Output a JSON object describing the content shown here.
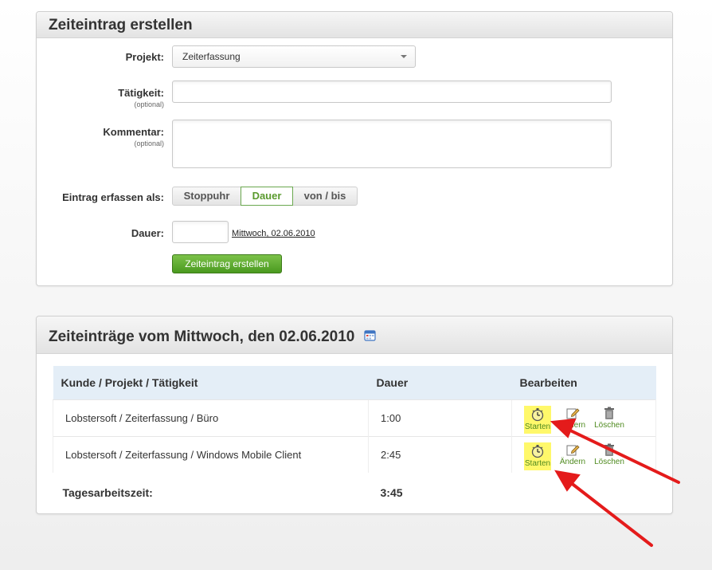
{
  "form": {
    "title": "Zeiteintrag erstellen",
    "project_label": "Projekt:",
    "project_value": "Zeiterfassung",
    "activity_label": "Tätigkeit:",
    "activity_hint": "(optional)",
    "comment_label": "Kommentar:",
    "comment_hint": "(optional)",
    "mode_label": "Eintrag erfassen als:",
    "modes": [
      "Stoppuhr",
      "Dauer",
      "von / bis"
    ],
    "active_mode": "Dauer",
    "duration_label": "Dauer:",
    "date_link": "Mittwoch, 02.06.2010",
    "submit_label": "Zeiteintrag erstellen"
  },
  "entries": {
    "title": "Zeiteinträge vom Mittwoch, den 02.06.2010",
    "columns": [
      "Kunde / Projekt / Tätigkeit",
      "Dauer",
      "Bearbeiten"
    ],
    "rows": [
      {
        "task": "Lobstersoft / Zeiterfassung / Büro",
        "duration": "1:00"
      },
      {
        "task": "Lobstersoft / Zeiterfassung / Windows Mobile Client",
        "duration": "2:45"
      }
    ],
    "actions": {
      "start": "Starten",
      "edit": "Ändern",
      "delete": "Löschen"
    },
    "total_label": "Tagesarbeitszeit:",
    "total_value": "3:45"
  },
  "colors": {
    "accent_green": "#4a9a1f",
    "highlight_yellow": "#fff86a",
    "arrow_red": "#e41b1b",
    "table_header_bg": "#e4eef7"
  }
}
